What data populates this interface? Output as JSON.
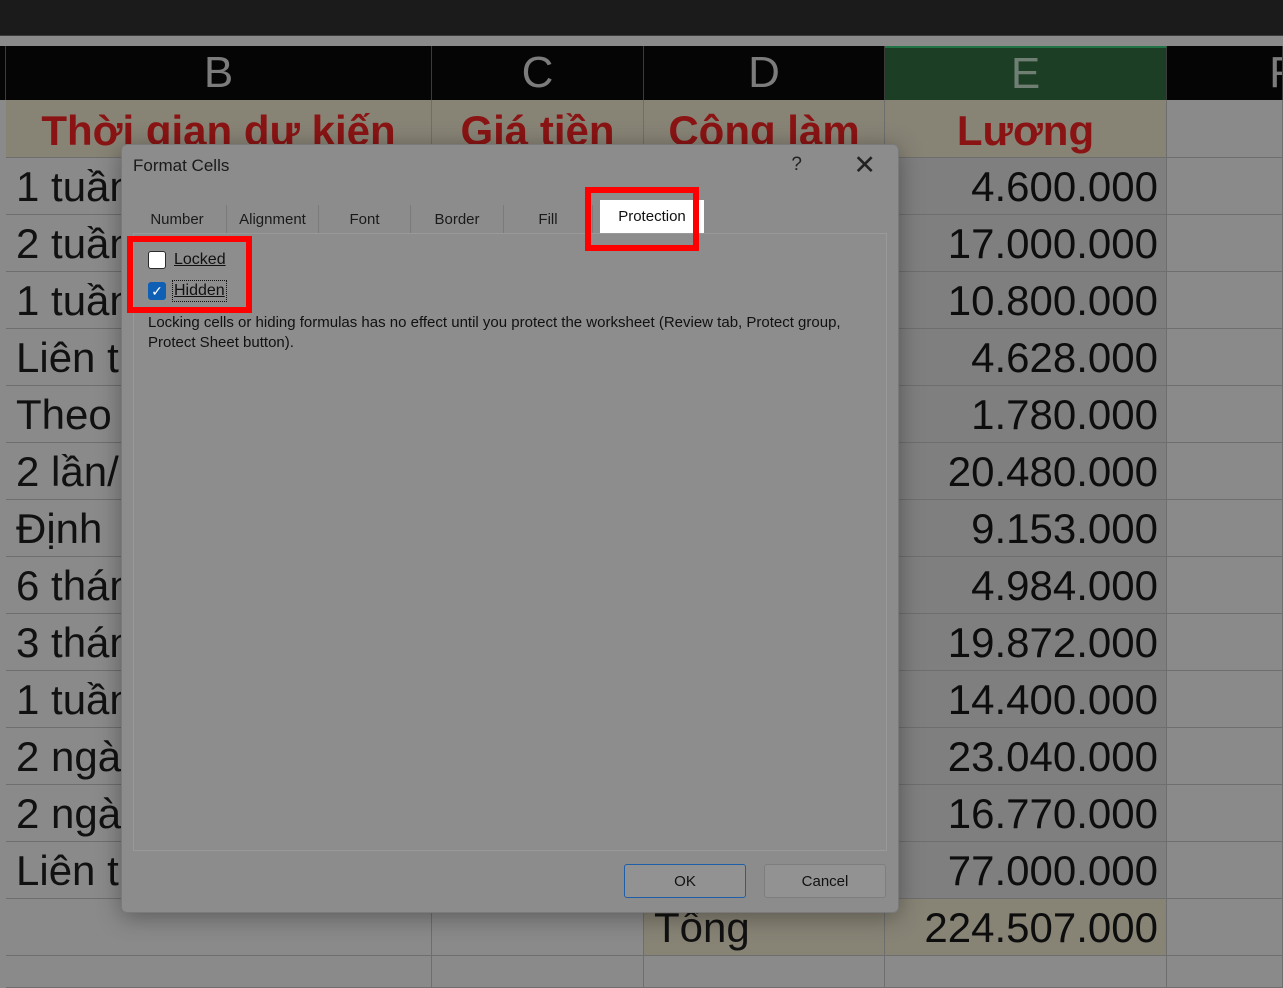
{
  "columns": {
    "b": "B",
    "c": "C",
    "d": "D",
    "e": "E",
    "f": "F"
  },
  "headers": {
    "b": "Thời gian dự kiến",
    "c": "Giá tiền",
    "d": "Công làm",
    "e": "Lương"
  },
  "b_cells": [
    "1 tuần",
    "2 tuần",
    "1 tuần",
    "Liên t",
    "Theo",
    "2 lần/",
    "Định",
    "6 thán",
    "3 thán",
    "1 tuần",
    "2 ngà",
    "2 ngà",
    "Liên t"
  ],
  "e_cells": [
    "4.600.000",
    "17.000.000",
    "10.800.000",
    "4.628.000",
    "1.780.000",
    "20.480.000",
    "9.153.000",
    "4.984.000",
    "19.872.000",
    "14.400.000",
    "23.040.000",
    "16.770.000",
    "77.000.000"
  ],
  "total": {
    "label": "Tổng",
    "value": "224.507.000"
  },
  "dialog": {
    "title": "Format Cells",
    "help": "?",
    "close": "✕",
    "tabs": [
      "Number",
      "Alignment",
      "Font",
      "Border",
      "Fill",
      "Protection"
    ],
    "active_tab": "Protection",
    "locked_label": "Locked",
    "locked_checked": false,
    "hidden_label": "Hidden",
    "hidden_checked": true,
    "info_line1": "Locking cells or hiding formulas has no effect until you protect the worksheet (Review tab, Protect group,",
    "info_line2": "Protect Sheet button).",
    "ok": "OK",
    "cancel": "Cancel"
  },
  "colors": {
    "highlight": "#ff0000",
    "header_text": "#8a1414",
    "checkbox_checked": "#0f5fb5"
  }
}
